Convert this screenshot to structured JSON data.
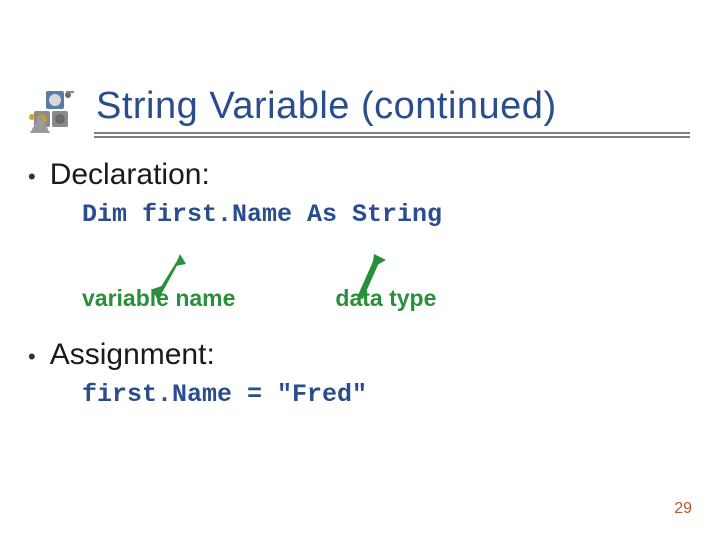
{
  "title": "String Variable (continued)",
  "bullets": [
    {
      "heading": "Declaration:",
      "code": "Dim first.Name As String"
    },
    {
      "heading": "Assignment:",
      "code": "first.Name = \"Fred\""
    }
  ],
  "labels": {
    "variable_name": "variable name",
    "data_type": "data type"
  },
  "page_number": "29"
}
